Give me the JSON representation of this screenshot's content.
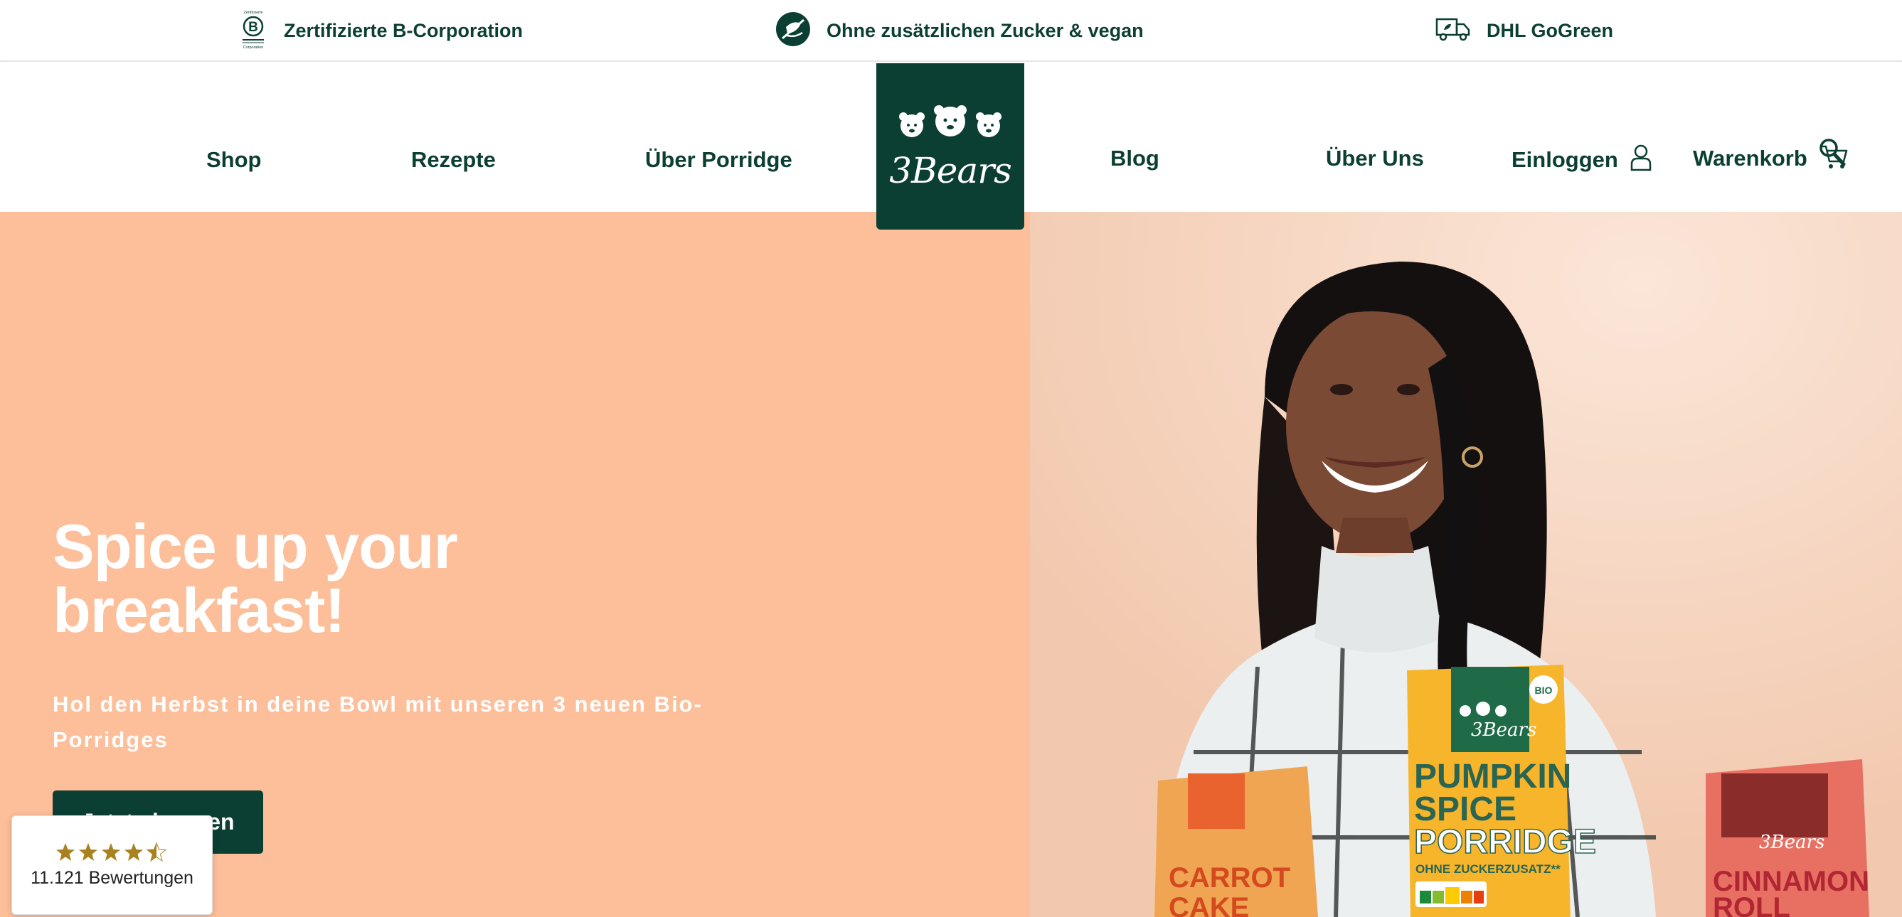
{
  "usp_bar": {
    "items": [
      {
        "icon": "b-corp-icon",
        "label": "Zertifizierte B-Corporation"
      },
      {
        "icon": "no-sugar-vegan-icon",
        "label": "Ohne zusätzlichen Zucker & vegan"
      },
      {
        "icon": "delivery-truck-icon",
        "label": "DHL GoGreen"
      }
    ],
    "bcorp_small_top": "Zertifizierte",
    "bcorp_small_bottom": "Corporation"
  },
  "nav": {
    "shop": "Shop",
    "rezepte": "Rezepte",
    "ueber_porridge": "Über Porridge",
    "blog": "Blog",
    "ueber_uns": "Über Uns",
    "login": "Einloggen",
    "cart": "Warenkorb"
  },
  "logo": {
    "text": "3Bears"
  },
  "hero": {
    "title": "Spice up your breakfast!",
    "subtitle": "Hol den Herbst in deine Bowl mit unseren 3 neuen Bio-Porridges",
    "cta": "Jetzt shoppen",
    "cta_visible": "...Jetzt shoppen"
  },
  "product_boxes": {
    "center_brand": "3Bears",
    "center_bio": "BIO",
    "center_name_line1": "PUMPKIN",
    "center_name_line2": "SPICE",
    "center_name_line3": "PORRIDGE",
    "center_claim": "OHNE ZUCKERZUSATZ**",
    "left_name_line1": "CARROT",
    "left_name_line2": "CAKE",
    "right_name_line1": "CINNAMON",
    "right_name_line2": "ROLL"
  },
  "rating": {
    "stars": 4.5,
    "count_label": "11.121 Bewertungen"
  },
  "colors": {
    "brand_green": "#0c3f33",
    "hero_peach": "#fdbe9a",
    "star_gold": "#a9821f"
  }
}
